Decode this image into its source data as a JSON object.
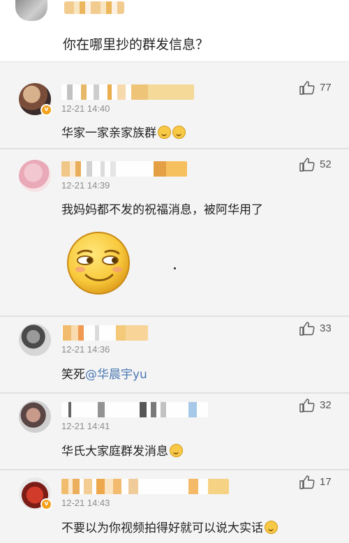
{
  "top_post": {
    "text": "你在哪里抄的群发信息？"
  },
  "comments": [
    {
      "time": "12-21 14:40",
      "text": "华家一家亲家族群",
      "likes": "77"
    },
    {
      "time": "12-21 14:39",
      "text": "我妈妈都不发的祝福消息，被阿华用了",
      "likes": "52"
    },
    {
      "time": "12-21 14:36",
      "text_prefix": "笑死",
      "mention": "@华晨宇yu",
      "likes": "33"
    },
    {
      "time": "12-21 14:41",
      "text": "华氏大家庭群发消息",
      "likes": "32"
    },
    {
      "time": "12-21 14:43",
      "text": "不要以为你视频拍得好就可以说大实话",
      "likes": "17"
    }
  ],
  "colors": {
    "mention": "#4b78b3",
    "badge": "#f4a21d",
    "background": "#f4f4f4"
  },
  "icons": {
    "like": "thumbs-up-icon",
    "emoji": "smile-emoji-icon",
    "verified": "verified-badge-icon"
  }
}
